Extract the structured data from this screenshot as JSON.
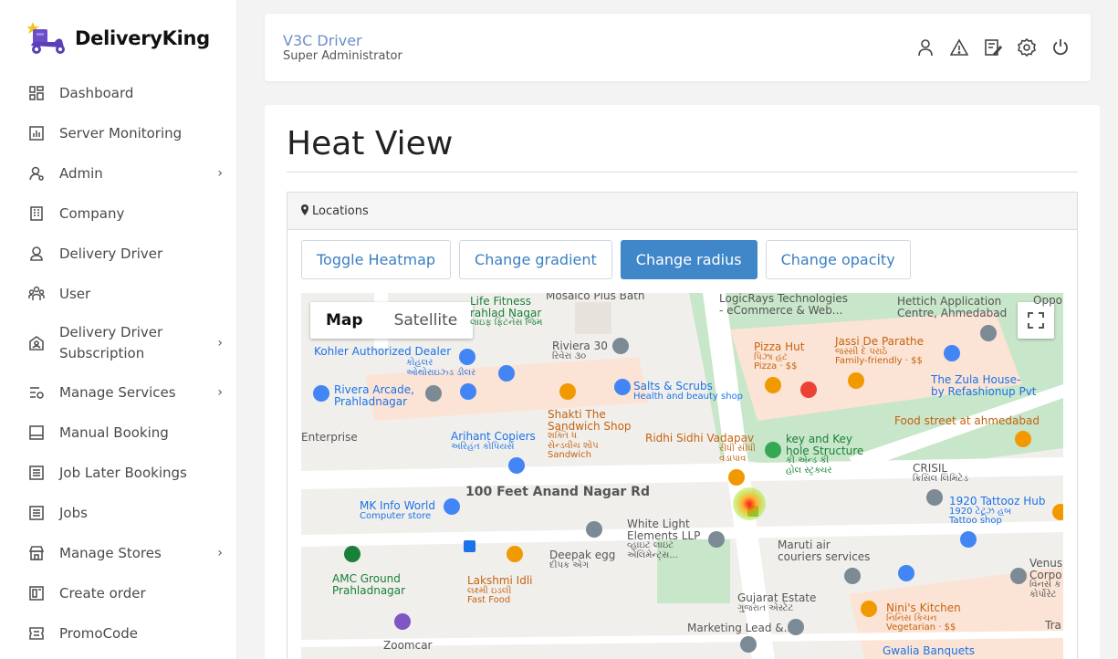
{
  "brand": {
    "name": "DeliveryKing"
  },
  "sidebar": {
    "items": [
      {
        "label": "Dashboard",
        "icon": "dashboard-icon",
        "has_submenu": false
      },
      {
        "label": "Server Monitoring",
        "icon": "chart-icon",
        "has_submenu": false
      },
      {
        "label": "Admin",
        "icon": "admin-user-icon",
        "has_submenu": true
      },
      {
        "label": "Company",
        "icon": "building-icon",
        "has_submenu": false
      },
      {
        "label": "Delivery Driver",
        "icon": "driver-icon",
        "has_submenu": false
      },
      {
        "label": "User",
        "icon": "users-icon",
        "has_submenu": false
      },
      {
        "label": "Delivery Driver Subscription",
        "icon": "subscription-icon",
        "has_submenu": true
      },
      {
        "label": "Manage Services",
        "icon": "services-icon",
        "has_submenu": true
      },
      {
        "label": "Manual Booking",
        "icon": "booking-icon",
        "has_submenu": false
      },
      {
        "label": "Job Later Bookings",
        "icon": "list-icon",
        "has_submenu": false
      },
      {
        "label": "Jobs",
        "icon": "jobs-icon",
        "has_submenu": false
      },
      {
        "label": "Manage Stores",
        "icon": "store-icon",
        "has_submenu": true
      },
      {
        "label": "Create order",
        "icon": "order-icon",
        "has_submenu": false
      },
      {
        "label": "PromoCode",
        "icon": "promo-icon",
        "has_submenu": false
      }
    ],
    "chevron": "›"
  },
  "topbar": {
    "user_name": "V3C Driver",
    "user_role": "Super Administrator",
    "icons": [
      "profile-icon",
      "alert-icon",
      "edit-icon",
      "settings-icon",
      "power-icon"
    ]
  },
  "page": {
    "title": "Heat View",
    "panel_title": "Locations",
    "buttons": [
      {
        "label": "Toggle Heatmap",
        "active": false
      },
      {
        "label": "Change gradient",
        "active": false
      },
      {
        "label": "Change radius",
        "active": true
      },
      {
        "label": "Change opacity",
        "active": false
      }
    ]
  },
  "map": {
    "tabs": {
      "map": "Map",
      "satellite": "Satellite"
    },
    "places": {
      "life_fitness": "Life Fitness",
      "life_fitness_2": "rahlad Nagar",
      "life_fitness_gu": "લાઇફ ફિટનેસ જિમ",
      "mosaico": "Mosaico Plus Bath",
      "logicrays": "LogicRays Technologies",
      "logicrays_2": "- eCommerce & Web...",
      "hettich": "Hettich Application",
      "hettich_2": "Centre, Ahmedabad",
      "oppo": "Oppo s",
      "kohler": "Kohler Authorized Dealer",
      "kohler_gu": "કોહલર",
      "kohler_gu2": "ઓથોરાઇઝ્ડ ડીલર",
      "riviera30": "Riviera 30",
      "riviera30_gu": "રિવેરા ૩૦",
      "pizza_hut": "Pizza Hut",
      "pizza_hut_gu": "પિઝા હટ",
      "pizza_hut_sub": "Pizza · $$",
      "jassi": "Jassi De Parathe",
      "jassi_gu": "જસ્સી દે પરાઠે",
      "jassi_sub": "Family-friendly · $$",
      "riviera_arcade": "Rivera Arcade,",
      "riviera_arcade_2": "Prahladnagar",
      "salts": "Salts & Scrubs",
      "salts_sub": "Health and beauty shop",
      "zula": "The Zula House-",
      "zula_2": "by Refashionup Pvt",
      "shakti": "Shakti The",
      "shakti_2": "Sandwich Shop",
      "shakti_gu": "શક્તિ ધ",
      "shakti_gu2": "સેન્ડવીચ શોપ",
      "shakti_sub": "Sandwich",
      "food_street": "Food street at ahmedabad",
      "enterprise": "Enterprise",
      "arihant": "Arihant Copiers",
      "arihant_gu": "અરિહંત કોપિયર્સ",
      "ridhi": "Ridhi Sidhi Vadapav",
      "ridhi_gu": "રીધી સીધી",
      "ridhi_gu2": "વડાપાવ",
      "keykey": "key and Key",
      "keykey_2": "hole Structure",
      "keykey_gu": "કી એન્ડ કી",
      "keykey_gu2": "હોલ સ્ટ્રક્ચર",
      "crisil": "CRISIL",
      "crisil_gu": "ક્રિસિલ લિમિટેડ",
      "road_100ft": "100 Feet Anand Nagar Rd",
      "mkinfo": "MK Info World",
      "mkinfo_sub": "Computer store",
      "tattoo": "1920 Tattooz Hub",
      "tattoo_gu": "1920 ટેટૂઝ હબ",
      "tattoo_sub": "Tattoo shop",
      "whitelight": "White Light",
      "whitelight_2": "Elements LLP",
      "whitelight_gu": "વ્હાઇટ લાઇટ",
      "whitelight_gu2": "એલિમેન્ટ્સ...",
      "maruti": "Maruti air",
      "maruti_2": "couriers services",
      "venus": "Venus",
      "venus_2": "Corpo",
      "venus_gu": "વિનસ ક",
      "venus_gu2": "કોર્પોરેટ",
      "amc": "AMC Ground",
      "amc_2": "Prahladnagar",
      "deepak": "Deepak egg",
      "deepak_gu": "દીપક એગ",
      "lakshmi": "Lakshmi Idli",
      "lakshmi_gu": "લક્ષ્મી ઇડલી",
      "lakshmi_sub": "Fast Food",
      "gujarat_estate": "Gujarat Estate",
      "gujarat_estate_gu": "ગુજરાત એસ્ટેટ",
      "ninis": "Nini's Kitchen",
      "ninis_gu": "નિનિસ કિચન",
      "ninis_sub": "Vegetarian · $$",
      "marketing": "Marketing Lead &...",
      "zoomcar": "Zoomcar",
      "gwalia": "Gwalia Banquets",
      "tra": "Tra"
    }
  },
  "colors": {
    "accent": "#3f87c8",
    "link": "#3a7ec2",
    "user_name": "#6a8fc8",
    "map_blue_label": "#1a73e8",
    "map_orange_label": "#c5620f",
    "map_green_label": "#188038",
    "park": "#c8e6c9",
    "poi_area": "#fbe4d5"
  }
}
